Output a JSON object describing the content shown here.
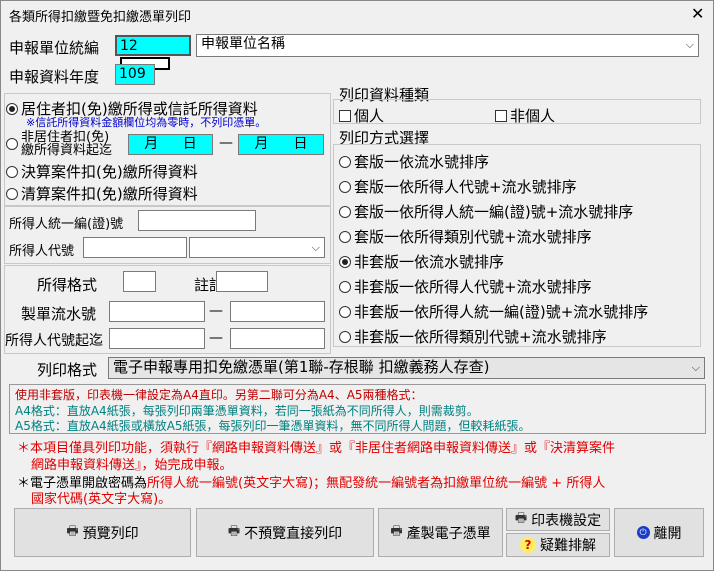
{
  "window": {
    "title": "各類所得扣繳暨免扣繳憑單列印",
    "close": "✕"
  },
  "unit": {
    "label": "申報單位統編",
    "value": "12",
    "name_placeholder": "申報單位名稱"
  },
  "year": {
    "label": "申報資料年度",
    "value": "109"
  },
  "data_type": {
    "opt1": "居住者扣(免)繳所得或信託所得資料",
    "note": "※信託所得資料金額欄位均為零時，不列印憑單。",
    "opt2_line1": "非居住者扣(免)",
    "opt2_line2": "繳所得資料起迄",
    "month": "月",
    "day": "日",
    "dash": "—",
    "opt3": "決算案件扣(免)繳所得資料",
    "opt4": "清算案件扣(免)繳所得資料"
  },
  "payee": {
    "id_label": "所得人統一編(證)號",
    "code_label": "所得人代號"
  },
  "filters": {
    "format_label": "所得格式",
    "remark_label": "註記",
    "serial_label": "製單流水號",
    "code_range_label": "所得人代號起迄",
    "dash": "—"
  },
  "print_kind": {
    "label": "列印資料種類",
    "personal": "個人",
    "non_personal": "非個人"
  },
  "print_method": {
    "label": "列印方式選擇",
    "options": [
      "套版一依流水號排序",
      "套版一依所得人代號+流水號排序",
      "套版一依所得人統一編(證)號+流水號排序",
      "套版一依所得類別代號+流水號排序",
      "非套版一依流水號排序",
      "非套版一依所得人代號+流水號排序",
      "非套版一依所得人統一編(證)號+流水號排序",
      "非套版一依所得類別代號+流水號排序"
    ],
    "selected": 4
  },
  "print_format": {
    "label": "列印格式",
    "value": "電子申報專用扣免繳憑單(第1聯-存根聯 扣繳義務人存查)"
  },
  "info": {
    "line1": "使用非套版，印表機一律設定為A4直印。另第二聯可分為A4、A5兩種格式：",
    "line2": "A4格式：直放A4紙張，每張列印兩筆憑單資料，若同一張紙為不同所得人，則需裁剪。",
    "line3": "A5格式：直放A4紙張或橫放A5紙張，每張列印一筆憑單資料，無不同所得人問題，但較耗紙張。"
  },
  "notes": {
    "n1a": "＊本項目僅具列印功能，須執行『網路申報資料傳送』或『非居住者網路申報資料傳送』或『決清算案件",
    "n1b": "網路申報資料傳送』，始完成申報。",
    "n2_prefix": "＊電子憑單開啟密碼為",
    "n2a": "所得人統一編號(英文字大寫)；無配發統一編號者為扣繳單位統一編號 + 所得人",
    "n2b": "國家代碼(英文字大寫)。"
  },
  "buttons": {
    "preview": "預覽列印",
    "direct": "不預覽直接列印",
    "export": "產製電子憑單",
    "printer": "印表機設定",
    "help": "疑難排解",
    "exit": "離開"
  }
}
